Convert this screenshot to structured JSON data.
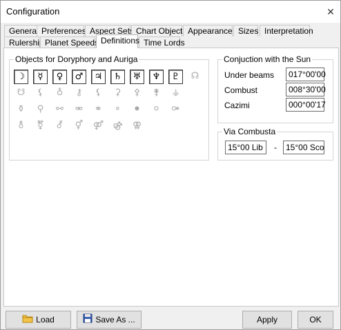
{
  "window": {
    "title": "Configuration",
    "close_glyph": "✕"
  },
  "tabs_row1": [
    "General",
    "Preferences",
    "Aspect Sets",
    "Chart Objects",
    "Appearance",
    "Sizes",
    "Interpretation"
  ],
  "tabs_row2": [
    "Rulership",
    "Planet Speeds",
    "Definitions",
    "Time Lords"
  ],
  "active_tab": "Definitions",
  "objects_group": {
    "title": "Objects for Doryphory and Auriga",
    "rows": [
      [
        {
          "glyph": "☽",
          "name": "moon",
          "checked": true
        },
        {
          "glyph": "☿",
          "name": "mercury",
          "checked": true
        },
        {
          "glyph": "♀",
          "name": "venus",
          "checked": true
        },
        {
          "glyph": "♂",
          "name": "mars",
          "checked": true
        },
        {
          "glyph": "♃",
          "name": "jupiter",
          "checked": true
        },
        {
          "glyph": "♄",
          "name": "saturn",
          "checked": true
        },
        {
          "glyph": "♅",
          "name": "uranus",
          "checked": true
        },
        {
          "glyph": "♆",
          "name": "neptune",
          "checked": true
        },
        {
          "glyph": "♇",
          "name": "pluto",
          "checked": true
        },
        {
          "glyph": "☊",
          "name": "north-node",
          "checked": false
        }
      ],
      [
        {
          "glyph": "☋",
          "name": "south-node",
          "checked": false
        },
        {
          "glyph": "⚸",
          "name": "lilith",
          "checked": false
        },
        {
          "glyph": "♁",
          "name": "earth",
          "checked": false
        },
        {
          "glyph": "⚷",
          "name": "chiron",
          "checked": false
        },
        {
          "glyph": "⚸",
          "name": "black-moon",
          "checked": false
        },
        {
          "glyph": "⚳",
          "name": "ceres",
          "checked": false
        },
        {
          "glyph": "⚴",
          "name": "pallas",
          "checked": false
        },
        {
          "glyph": "⚵",
          "name": "juno",
          "checked": false
        },
        {
          "glyph": "⚶",
          "name": "vesta",
          "checked": false
        }
      ],
      [
        {
          "glyph": "⚱",
          "name": "obj-20",
          "checked": false
        },
        {
          "glyph": "⚲",
          "name": "obj-21",
          "checked": false
        },
        {
          "glyph": "⚯",
          "name": "obj-22",
          "checked": false
        },
        {
          "glyph": "⚮",
          "name": "obj-23",
          "checked": false
        },
        {
          "glyph": "⚭",
          "name": "obj-24",
          "checked": false
        },
        {
          "glyph": "⚬",
          "name": "obj-25",
          "checked": false
        },
        {
          "glyph": "⚫",
          "name": "obj-26",
          "checked": false
        },
        {
          "glyph": "⚪",
          "name": "obj-27",
          "checked": false
        },
        {
          "glyph": "⚩",
          "name": "obj-28",
          "checked": false
        }
      ],
      [
        {
          "glyph": "⚨",
          "name": "obj-29",
          "checked": false
        },
        {
          "glyph": "⚧",
          "name": "obj-30",
          "checked": false
        },
        {
          "glyph": "⚦",
          "name": "obj-31",
          "checked": false
        },
        {
          "glyph": "⚥",
          "name": "obj-32",
          "checked": false
        },
        {
          "glyph": "⚤",
          "name": "obj-33",
          "checked": false
        },
        {
          "glyph": "⚣",
          "name": "obj-34",
          "checked": false
        },
        {
          "glyph": "⚢",
          "name": "obj-35",
          "checked": false
        }
      ]
    ]
  },
  "sun_group": {
    "title": "Conjuction with the Sun",
    "rows": [
      {
        "label": "Under beams",
        "value": "017°00'00"
      },
      {
        "label": "Combust",
        "value": "008°30'00"
      },
      {
        "label": "Cazimi",
        "value": "000°00'17"
      }
    ]
  },
  "via_group": {
    "title": "Via Combusta",
    "from": "15°00 Lib",
    "separator": "-",
    "to": "15°00 Sco"
  },
  "buttons": {
    "load": "Load",
    "save_as": "Save As ...",
    "apply": "Apply",
    "ok": "OK"
  }
}
